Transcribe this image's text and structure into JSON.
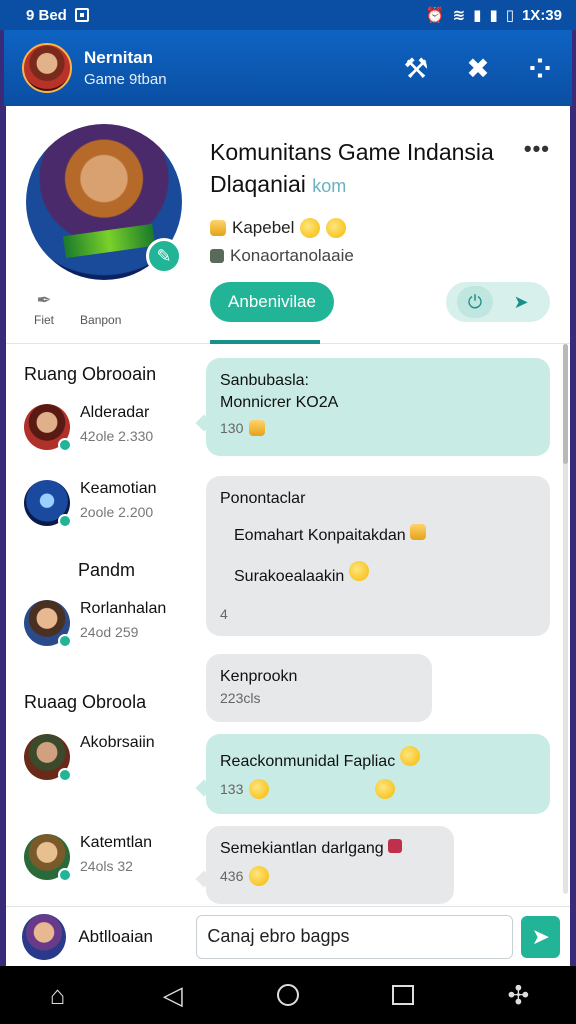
{
  "status_bar": {
    "left": "9 Bed",
    "time": "1X:39"
  },
  "app_bar": {
    "title": "Nernitan",
    "subtitle": "Game 9tban"
  },
  "header": {
    "group_title": "Komunitans Game Indansia",
    "handle_name": "Dlaqaniai",
    "handle_tag": "kom",
    "meta1": "Kapebel",
    "meta2": "Konaortanolaaie",
    "join_button": "Anbenivilae",
    "side1": "Fiet",
    "side2": "Banpon"
  },
  "sidebar": {
    "section1": "Ruang Obrooain",
    "section2": "Pandm",
    "section3": "Ruaag Obroola",
    "channels": [
      {
        "name": "Alderadar",
        "count": "42ole 2.330"
      },
      {
        "name": "Keamotian",
        "count": "2oole 2.200"
      },
      {
        "name": "Rorlanhalan",
        "count": "24od 259"
      },
      {
        "name": "Akobrsaiin",
        "count": ""
      },
      {
        "name": "Katemtlan",
        "count": "24ols 32"
      }
    ]
  },
  "messages": [
    {
      "line1": "Sanbubasla:",
      "line2": "Monnicrer KO2A",
      "meta": "130"
    },
    {
      "line1": "Ponontaclar",
      "line2": "Eomahart Konpaitakdan",
      "line3": "Surakoealaakin",
      "meta": "4"
    },
    {
      "line1": "Kenprookn",
      "meta": "223cls"
    },
    {
      "line1": "Reackonmunidal Fapliac",
      "meta": "133"
    },
    {
      "line1": "Semekiantlan darlgang",
      "meta": "436"
    }
  ],
  "composer": {
    "name": "Abtlloaian",
    "value": "Canaj ebro bagps"
  }
}
